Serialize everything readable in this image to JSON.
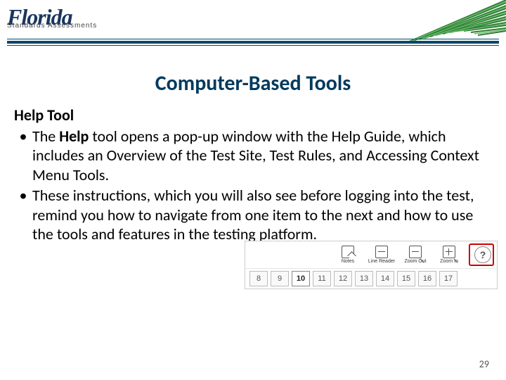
{
  "header": {
    "brand": "Florida",
    "brand_sub": "Standards Assessments"
  },
  "title": "Computer-Based Tools",
  "section_heading": "Help Tool",
  "bullets": [
    {
      "before": "The ",
      "bold": "Help",
      "after": " tool opens a pop-up window with the Help Guide, which includes an Overview of the Test Site, Test Rules, and Accessing Context Menu Tools."
    },
    {
      "before": "These instructions, which you will also see before logging into the test, remind you how to navigate from one item to the next and how to use the tools and features in the testing platform.",
      "bold": "",
      "after": ""
    }
  ],
  "toolbar": {
    "tools": [
      {
        "icon": "notes-icon",
        "label": "Notes"
      },
      {
        "icon": "line-reader-icon",
        "label": "Line Reader"
      },
      {
        "icon": "zoom-out-icon",
        "label": "Zoom Out"
      },
      {
        "icon": "zoom-in-icon",
        "label": "Zoom In"
      }
    ],
    "help_glyph": "?",
    "nav": [
      "8",
      "9",
      "10",
      "11",
      "12",
      "13",
      "14",
      "15",
      "16",
      "17"
    ],
    "nav_active": "10"
  },
  "page_number": "29"
}
